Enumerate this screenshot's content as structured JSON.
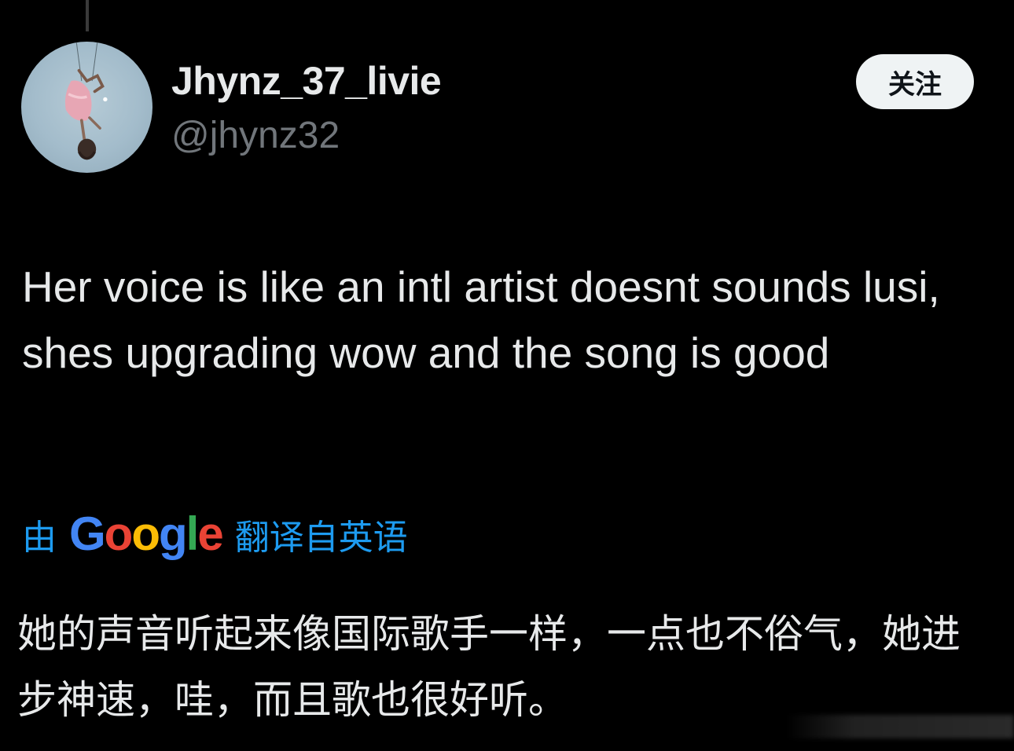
{
  "tweet": {
    "author": {
      "display_name": "Jhynz_37_livie",
      "handle": "@jhynz32",
      "avatar_icon": "avatar-photo"
    },
    "follow_button_label": "关注",
    "text": "Her voice is like an intl artist doesnt sounds lusi, shes upgrading wow and the song is good",
    "translation": {
      "by_label": "由",
      "provider_letters": [
        "G",
        "o",
        "o",
        "g",
        "l",
        "e"
      ],
      "from_label": "翻译自英语",
      "text": "她的声音听起来像国际歌手一样，一点也不俗气，她进步神速，哇，而且歌也很好听。"
    }
  },
  "colors": {
    "background": "#000000",
    "primary_text": "#e7e9ea",
    "secondary_text": "#71767b",
    "link": "#1d9bf0",
    "follow_button_bg": "#eff3f4",
    "google_blue": "#4285f4",
    "google_red": "#ea4335",
    "google_yellow": "#fbbc05",
    "google_green": "#34a853"
  }
}
